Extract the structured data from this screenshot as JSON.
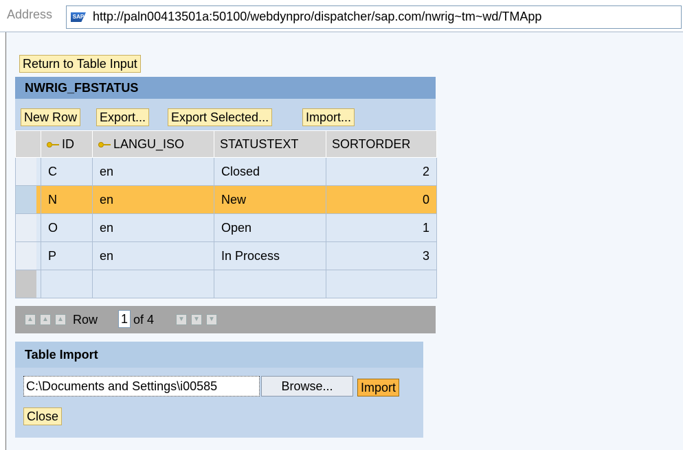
{
  "address": {
    "label": "Address",
    "url": "http://paln00413501a:50100/webdynpro/dispatcher/sap.com/nwrig~tm~wd/TMApp"
  },
  "toolbar": {
    "return_label": "Return to Table Input"
  },
  "table": {
    "title": "NWRIG_FBSTATUS",
    "buttons": [
      "New Row",
      "Export...",
      "Export Selected...",
      "Import..."
    ],
    "columns": [
      "ID",
      "LANGU_ISO",
      "STATUSTEXT",
      "SORTORDER"
    ],
    "rows": [
      {
        "id": "C",
        "langu": "en",
        "text": "Closed",
        "sort": "2"
      },
      {
        "id": "N",
        "langu": "en",
        "text": "New",
        "sort": "0"
      },
      {
        "id": "O",
        "langu": "en",
        "text": "Open",
        "sort": "1"
      },
      {
        "id": "P",
        "langu": "en",
        "text": "In Process",
        "sort": "3"
      }
    ],
    "selected_row": 1,
    "pager": {
      "row_label": "Row",
      "row_value": "1",
      "of_label": "of 4"
    }
  },
  "import": {
    "title": "Table Import",
    "file_value": "C:\\Documents and Settings\\i00585",
    "browse_label": "Browse...",
    "import_label": "Import",
    "close_label": "Close"
  }
}
